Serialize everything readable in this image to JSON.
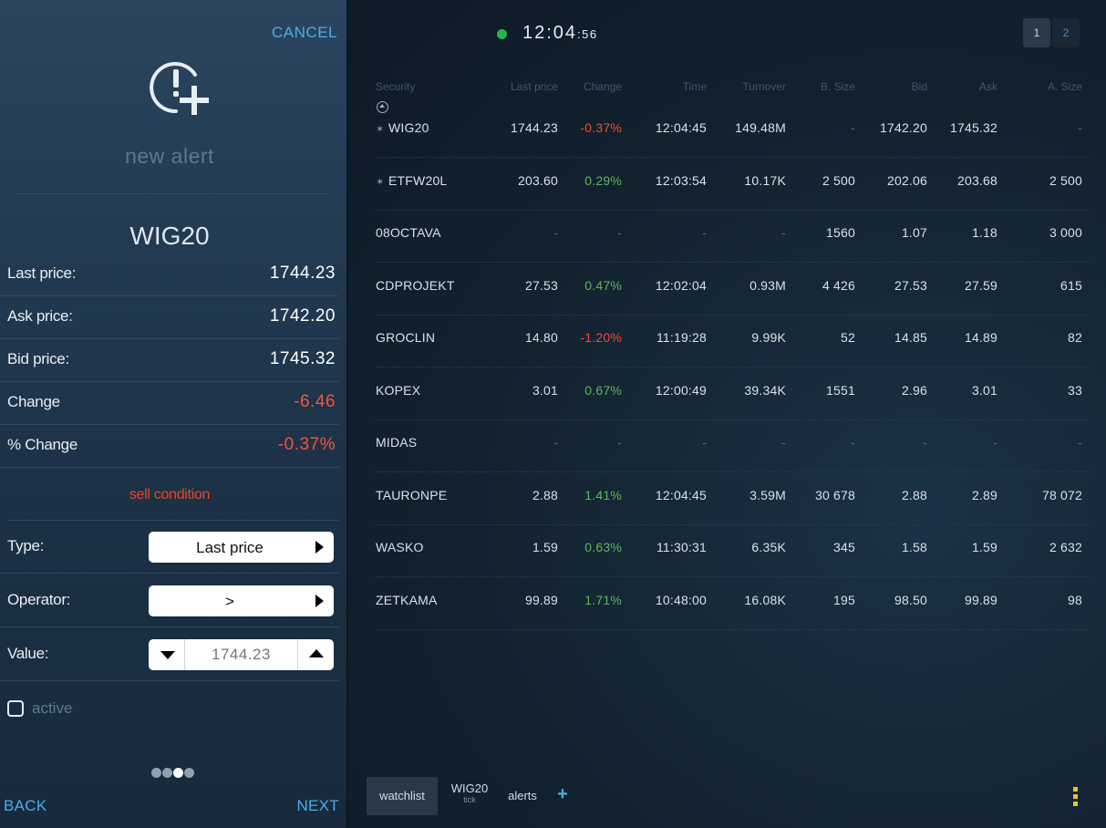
{
  "alert_panel": {
    "cancel_label": "CANCEL",
    "icon": "alert-add-icon",
    "title": "new alert",
    "symbol": "WIG20",
    "info_rows": [
      {
        "label": "Last price:",
        "value": "1744.23",
        "negative": false
      },
      {
        "label": "Ask price:",
        "value": "1742.20",
        "negative": false
      },
      {
        "label": "Bid price:",
        "value": "1745.32",
        "negative": false
      },
      {
        "label": "Change",
        "value": "-6.46",
        "negative": true
      },
      {
        "label": "% Change",
        "value": "-0.37%",
        "negative": true
      }
    ],
    "condition_title": "sell condition",
    "type": {
      "label": "Type:",
      "value": "Last price"
    },
    "operator": {
      "label": "Operator:",
      "value": ">"
    },
    "value_field": {
      "label": "Value:",
      "placeholder": "1744.23"
    },
    "active_label": "active",
    "active_checked": false,
    "steps_total": 4,
    "current_step": 3,
    "back_label": "BACK",
    "next_label": "NEXT"
  },
  "header": {
    "status_color": "#27b34b",
    "clock_hm": "12:04",
    "clock_s": ":56",
    "pages": [
      "1",
      "2"
    ],
    "active_page": 0
  },
  "table": {
    "columns": [
      "Security",
      "Last price",
      "Change",
      "Time",
      "Turnover",
      "B. Size",
      "Bid",
      "Ask",
      "A. Size"
    ],
    "rows": [
      {
        "security": "WIG20",
        "pinned": true,
        "last": "1744.23",
        "change": "-0.37%",
        "dir": "neg",
        "time": "12:04:45",
        "turnover": "149.48M",
        "bsize": "-",
        "bid": "1742.20",
        "ask": "1745.32",
        "asize": "-"
      },
      {
        "security": "ETFW20L",
        "pinned": true,
        "last": "203.60",
        "change": "0.29%",
        "dir": "pos",
        "time": "12:03:54",
        "turnover": "10.17K",
        "bsize": "2 500",
        "bid": "202.06",
        "ask": "203.68",
        "asize": "2 500"
      },
      {
        "security": "08OCTAVA",
        "pinned": false,
        "last": "-",
        "change": "-",
        "dir": "none",
        "time": "-",
        "turnover": "-",
        "bsize": "1560",
        "bid": "1.07",
        "ask": "1.18",
        "asize": "3 000"
      },
      {
        "security": "CDPROJEKT",
        "pinned": false,
        "last": "27.53",
        "change": "0.47%",
        "dir": "pos",
        "time": "12:02:04",
        "turnover": "0.93M",
        "bsize": "4 426",
        "bid": "27.53",
        "ask": "27.59",
        "asize": "615"
      },
      {
        "security": "GROCLIN",
        "pinned": false,
        "last": "14.80",
        "change": "-1.20%",
        "dir": "neg",
        "time": "11:19:28",
        "turnover": "9.99K",
        "bsize": "52",
        "bid": "14.85",
        "ask": "14.89",
        "asize": "82"
      },
      {
        "security": "KOPEX",
        "pinned": false,
        "last": "3.01",
        "change": "0.67%",
        "dir": "pos",
        "time": "12:00:49",
        "turnover": "39.34K",
        "bsize": "1551",
        "bid": "2.96",
        "ask": "3.01",
        "asize": "33"
      },
      {
        "security": "MIDAS",
        "pinned": false,
        "last": "-",
        "change": "-",
        "dir": "none",
        "time": "-",
        "turnover": "-",
        "bsize": "-",
        "bid": "-",
        "ask": "-",
        "asize": "-"
      },
      {
        "security": "TAURONPE",
        "pinned": false,
        "last": "2.88",
        "change": "1.41%",
        "dir": "pos",
        "time": "12:04:45",
        "turnover": "3.59M",
        "bsize": "30 678",
        "bid": "2.88",
        "ask": "2.89",
        "asize": "78 072"
      },
      {
        "security": "WASKO",
        "pinned": false,
        "last": "1.59",
        "change": "0.63%",
        "dir": "pos",
        "time": "11:30:31",
        "turnover": "6.35K",
        "bsize": "345",
        "bid": "1.58",
        "ask": "1.59",
        "asize": "2 632"
      },
      {
        "security": "ZETKAMA",
        "pinned": false,
        "last": "99.89",
        "change": "1.71%",
        "dir": "pos",
        "time": "10:48:00",
        "turnover": "16.08K",
        "bsize": "195",
        "bid": "98.50",
        "ask": "99.89",
        "asize": "98"
      }
    ]
  },
  "tabs": [
    {
      "label": "watchlist",
      "sub": "",
      "active": true
    },
    {
      "label": "WIG20",
      "sub": "tick",
      "active": false
    },
    {
      "label": "alerts",
      "sub": "",
      "active": false
    }
  ],
  "add_tab_label": "+",
  "colors": {
    "accent": "#4aaee8",
    "negative": "#ef4b35",
    "positive": "#5cb85c",
    "menu": "#f0c22b"
  }
}
